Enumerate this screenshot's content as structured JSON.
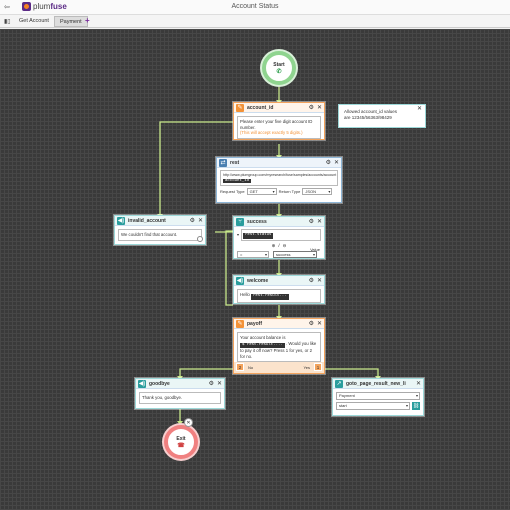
{
  "app": {
    "logo_text_plum": "plum",
    "logo_text_fuse": "fuse",
    "title": "Account Status"
  },
  "tabs": [
    {
      "label": "Get Account"
    },
    {
      "label": "Payment"
    }
  ],
  "start": {
    "label": "Start"
  },
  "exit": {
    "label": "Exit"
  },
  "nodes": {
    "account_id": {
      "name": "account_id",
      "prompt": "Please enter your five digit account ID number.",
      "hint": "(This will accept exactly 5 digits.)"
    },
    "rest": {
      "name": "rest",
      "url": "http://www.plumgroup.com/myresearch/fuse/samples/accounts/account",
      "token": "account_id",
      "request_type_label": "Request Type",
      "request_type": "GET",
      "return_type_label": "Return Type",
      "return_type": "JSON"
    },
    "invalid_account": {
      "name": "invalid_account",
      "text": "We couldn't find that account."
    },
    "success": {
      "name": "success",
      "token": "rest.status",
      "value_label": "Value",
      "operator": "=",
      "value": "success"
    },
    "welcome": {
      "name": "welcome",
      "text": "Hello",
      "token": "rest.result..."
    },
    "payoff": {
      "name": "payoff",
      "text1": "Your account balance is",
      "token": "$ rest.result....",
      "text2": ". Would you like to pay it off now? Press 1 for yes, or 2 for no.",
      "no_key": "2",
      "no_label": "No",
      "yes_label": "Yes",
      "yes_key": "1"
    },
    "goodbye": {
      "name": "goodbye",
      "text": "Thank you, goodbye."
    },
    "goto_page": {
      "name": "goto_page_result_new_li",
      "page": "Payment",
      "entry": "start"
    }
  },
  "note": {
    "line1": "Allowed account_id values",
    "line2": "are 12345/56363/98429"
  },
  "colors": {
    "canvas": "#3a3a3a",
    "wire": "#c8e88a",
    "start_ring": "#8fd48f",
    "exit_ring": "#f08080",
    "audio_node": "#9cd8d8",
    "input_node": "#f3a35c",
    "rest_node": "#8db5d6",
    "brand": "#5b2a86"
  }
}
